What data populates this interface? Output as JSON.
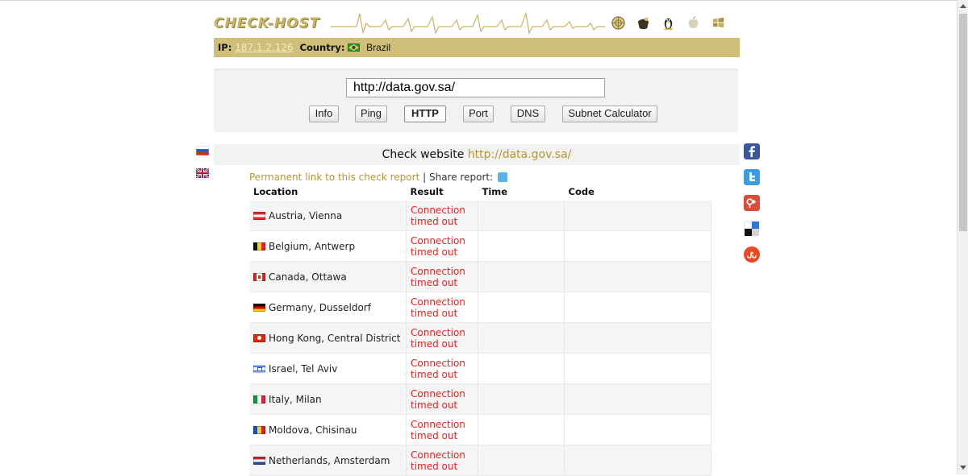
{
  "logo": "CHECK-HOST",
  "os_icons": [
    "world-icon",
    "bsd-icon",
    "linux-icon",
    "apple-icon",
    "windows-icon"
  ],
  "ipbar": {
    "ip_label": "IP:",
    "ip_value": "187.1.2.126",
    "country_label": "Country:",
    "country_value": "Brazil"
  },
  "form": {
    "url_value": "http://data.gov.sa/",
    "buttons": [
      "Info",
      "Ping",
      "HTTP",
      "Port",
      "DNS",
      "Subnet Calculator"
    ],
    "active_button": "HTTP"
  },
  "language_flags": [
    "russia-flag-icon",
    "uk-flag-icon"
  ],
  "panel": {
    "title_prefix": "Check website",
    "title_url": "http://data.gov.sa/",
    "permalink": "Permanent link to this check report",
    "separator": "|",
    "share_label": "Share report:"
  },
  "table": {
    "headers": [
      "Location",
      "Result",
      "Time",
      "Code"
    ],
    "rows": [
      {
        "location": "Austria, Vienna",
        "result_line1": "Connection",
        "result_line2": "timed out",
        "time": "",
        "code": ""
      },
      {
        "location": "Belgium, Antwerp",
        "result_line1": "Connection",
        "result_line2": "timed out",
        "time": "",
        "code": ""
      },
      {
        "location": "Canada, Ottawa",
        "result_line1": "Connection",
        "result_line2": "timed out",
        "time": "",
        "code": ""
      },
      {
        "location": "Germany, Dusseldorf",
        "result_line1": "Connection",
        "result_line2": "timed out",
        "time": "",
        "code": ""
      },
      {
        "location": "Hong Kong, Central District",
        "result_line1": "Connection",
        "result_line2": "timed out",
        "time": "",
        "code": ""
      },
      {
        "location": "Israel, Tel Aviv",
        "result_line1": "Connection",
        "result_line2": "timed out",
        "time": "",
        "code": ""
      },
      {
        "location": "Italy, Milan",
        "result_line1": "Connection",
        "result_line2": "timed out",
        "time": "",
        "code": ""
      },
      {
        "location": "Moldova, Chisinau",
        "result_line1": "Connection",
        "result_line2": "timed out",
        "time": "",
        "code": ""
      },
      {
        "location": "Netherlands, Amsterdam",
        "result_line1": "Connection",
        "result_line2": "timed out",
        "time": "",
        "code": ""
      }
    ]
  },
  "social": [
    "facebook-icon",
    "twitter-icon",
    "google-plus-icon",
    "delicious-icon",
    "stumbleupon-icon"
  ],
  "colors": {
    "gold": "#cfbf78",
    "link_gold": "#b8962e",
    "error_red": "#e32222"
  }
}
